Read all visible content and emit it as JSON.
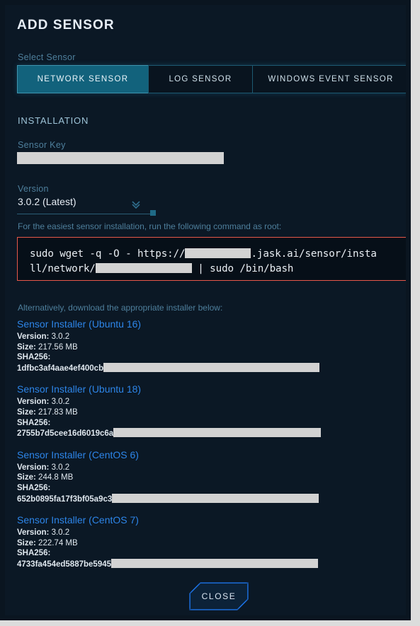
{
  "dialog": {
    "title": "ADD SENSOR"
  },
  "select_sensor": {
    "label": "Select Sensor",
    "tabs": [
      {
        "label": "NETWORK SENSOR",
        "active": true
      },
      {
        "label": "LOG SENSOR",
        "active": false
      },
      {
        "label": "WINDOWS EVENT SENSOR",
        "active": false
      }
    ]
  },
  "installation": {
    "heading": "INSTALLATION",
    "sensor_key": {
      "label": "Sensor Key",
      "value": "",
      "redacted": true
    },
    "version": {
      "label": "Version",
      "selected": "3.0.2 (Latest)",
      "chevron_icon": "chevron-double-down-icon"
    },
    "command_hint": "For the easiest sensor installation, run the following command as root:",
    "command": {
      "line1_prefix": "sudo wget -q -O - https://",
      "line1_suffix": ".jask.ai/sensor/insta",
      "line2_prefix": "ll/network/",
      "line2_suffix": " | sudo /bin/bash",
      "border_color": "#e8584a"
    },
    "alternatively": "Alternatively, download the appropriate installer below:"
  },
  "installers": [
    {
      "name": "Sensor Installer (Ubuntu 16)",
      "version_label": "Version:",
      "version": "3.0.2",
      "size_label": "Size:",
      "size": "217.56 MB",
      "sha_label": "SHA256:",
      "sha_prefix": "1dfbc3af4aae4ef400cb",
      "redact_width": 305
    },
    {
      "name": "Sensor Installer (Ubuntu 18)",
      "version_label": "Version:",
      "version": "3.0.2",
      "size_label": "Size:",
      "size": "217.83 MB",
      "sha_label": "SHA256:",
      "sha_prefix": "2755b7d5cee16d6019c6a",
      "redact_width": 293
    },
    {
      "name": "Sensor Installer (CentOS 6)",
      "version_label": "Version:",
      "version": "3.0.2",
      "size_label": "Size:",
      "size": "244.8 MB",
      "sha_label": "SHA256:",
      "sha_prefix": "652b0895fa17f3bf05a9c3",
      "redact_width": 292
    },
    {
      "name": "Sensor Installer (CentOS 7)",
      "version_label": "Version:",
      "version": "3.0.2",
      "size_label": "Size:",
      "size": "222.74 MB",
      "sha_label": "SHA256:",
      "sha_prefix": "4733fa454ed5887be5945",
      "redact_width": 292
    }
  ],
  "footer": {
    "close_label": "CLOSE"
  },
  "colors": {
    "panel_bg": "#0b1825",
    "outer_bg": "#0a1520",
    "accent_teal": "#12627c",
    "label_teal": "#4e7f9c",
    "link_blue": "#2d85e8",
    "command_border": "#e8584a",
    "close_glow": "#1f7fff",
    "redaction": "#d2d2d2"
  }
}
